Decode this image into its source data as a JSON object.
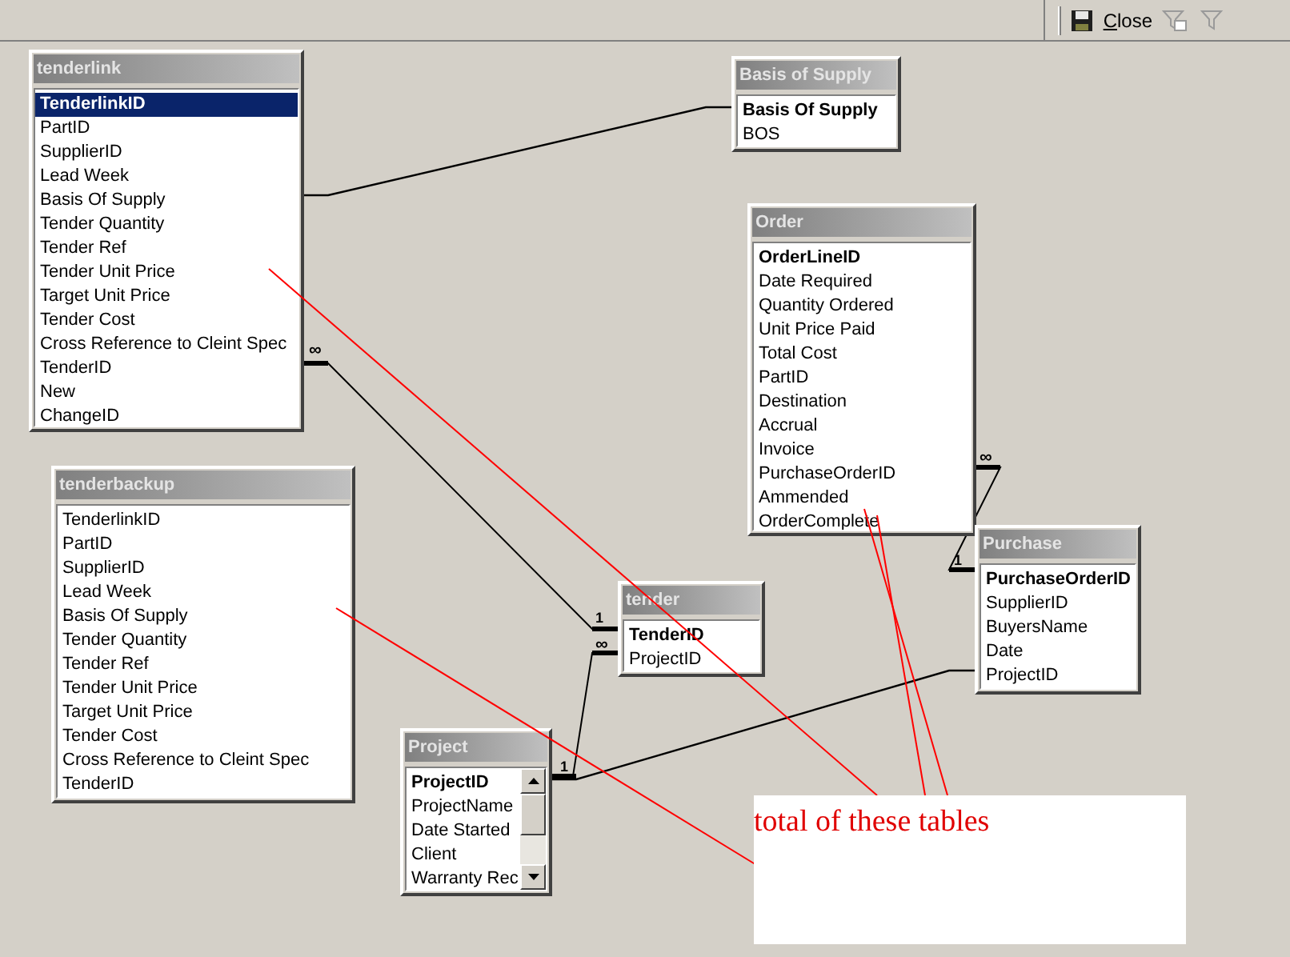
{
  "toolbar": {
    "close_label": "Close",
    "filter_disabled": true
  },
  "tables": [
    {
      "title": "tenderlink",
      "fields": [
        {
          "name": "TenderlinkID",
          "key": true,
          "selected": true
        },
        {
          "name": "PartID",
          "key": false,
          "selected": false
        },
        {
          "name": "SupplierID",
          "key": false,
          "selected": false
        },
        {
          "name": "Lead Week",
          "key": false,
          "selected": false
        },
        {
          "name": "Basis Of Supply",
          "key": false,
          "selected": false
        },
        {
          "name": "Tender Quantity",
          "key": false,
          "selected": false
        },
        {
          "name": "Tender Ref",
          "key": false,
          "selected": false
        },
        {
          "name": "Tender Unit Price",
          "key": false,
          "selected": false
        },
        {
          "name": "Target Unit Price",
          "key": false,
          "selected": false
        },
        {
          "name": "Tender Cost",
          "key": false,
          "selected": false
        },
        {
          "name": "Cross Reference to Cleint Spec",
          "key": false,
          "selected": false
        },
        {
          "name": "TenderID",
          "key": false,
          "selected": false
        },
        {
          "name": "New",
          "key": false,
          "selected": false
        },
        {
          "name": "ChangeID",
          "key": false,
          "selected": false
        }
      ]
    },
    {
      "title": "Basis of Supply",
      "fields": [
        {
          "name": "Basis Of Supply",
          "key": true,
          "selected": false
        },
        {
          "name": "BOS",
          "key": false,
          "selected": false
        }
      ]
    },
    {
      "title": "Order",
      "fields": [
        {
          "name": "OrderLineID",
          "key": true,
          "selected": false
        },
        {
          "name": "Date Required",
          "key": false,
          "selected": false
        },
        {
          "name": "Quantity Ordered",
          "key": false,
          "selected": false
        },
        {
          "name": "Unit Price Paid",
          "key": false,
          "selected": false
        },
        {
          "name": "Total Cost",
          "key": false,
          "selected": false
        },
        {
          "name": "PartID",
          "key": false,
          "selected": false
        },
        {
          "name": "Destination",
          "key": false,
          "selected": false
        },
        {
          "name": "Accrual",
          "key": false,
          "selected": false
        },
        {
          "name": "Invoice",
          "key": false,
          "selected": false
        },
        {
          "name": "PurchaseOrderID",
          "key": false,
          "selected": false
        },
        {
          "name": "Ammended",
          "key": false,
          "selected": false
        },
        {
          "name": "OrderComplete",
          "key": false,
          "selected": false
        }
      ]
    },
    {
      "title": "tenderbackup",
      "fields": [
        {
          "name": "TenderlinkID",
          "key": false,
          "selected": false
        },
        {
          "name": "PartID",
          "key": false,
          "selected": false
        },
        {
          "name": "SupplierID",
          "key": false,
          "selected": false
        },
        {
          "name": "Lead Week",
          "key": false,
          "selected": false
        },
        {
          "name": "Basis Of Supply",
          "key": false,
          "selected": false
        },
        {
          "name": "Tender Quantity",
          "key": false,
          "selected": false
        },
        {
          "name": "Tender Ref",
          "key": false,
          "selected": false
        },
        {
          "name": "Tender Unit Price",
          "key": false,
          "selected": false
        },
        {
          "name": "Target Unit Price",
          "key": false,
          "selected": false
        },
        {
          "name": "Tender Cost",
          "key": false,
          "selected": false
        },
        {
          "name": "Cross Reference to Cleint Spec",
          "key": false,
          "selected": false
        },
        {
          "name": "TenderID",
          "key": false,
          "selected": false
        }
      ]
    },
    {
      "title": "tender",
      "fields": [
        {
          "name": "TenderID",
          "key": true,
          "selected": false
        },
        {
          "name": "ProjectID",
          "key": false,
          "selected": false
        }
      ]
    },
    {
      "title": "Project",
      "scrollbar": true,
      "fields": [
        {
          "name": "ProjectID",
          "key": true,
          "selected": false
        },
        {
          "name": "ProjectName",
          "key": false,
          "selected": false
        },
        {
          "name": "Date Started",
          "key": false,
          "selected": false
        },
        {
          "name": "Client",
          "key": false,
          "selected": false
        },
        {
          "name": "Warranty Rec",
          "key": false,
          "selected": false
        }
      ]
    },
    {
      "title": "Purchase",
      "fields": [
        {
          "name": "PurchaseOrderID",
          "key": true,
          "selected": false
        },
        {
          "name": "SupplierID",
          "key": false,
          "selected": false
        },
        {
          "name": "BuyersName",
          "key": false,
          "selected": false
        },
        {
          "name": "Date",
          "key": false,
          "selected": false
        },
        {
          "name": "ProjectID",
          "key": false,
          "selected": false
        }
      ]
    }
  ],
  "relationships": [
    {
      "kind": "plain"
    },
    {
      "kind": "enforced",
      "from_mark": "∞",
      "to_mark": "1"
    },
    {
      "kind": "enforced",
      "from_mark": "∞",
      "to_mark": "1"
    },
    {
      "kind": "plain"
    },
    {
      "kind": "enforced",
      "from_mark": "∞",
      "to_mark": "1"
    }
  ],
  "note": {
    "text": "total of these tables"
  }
}
